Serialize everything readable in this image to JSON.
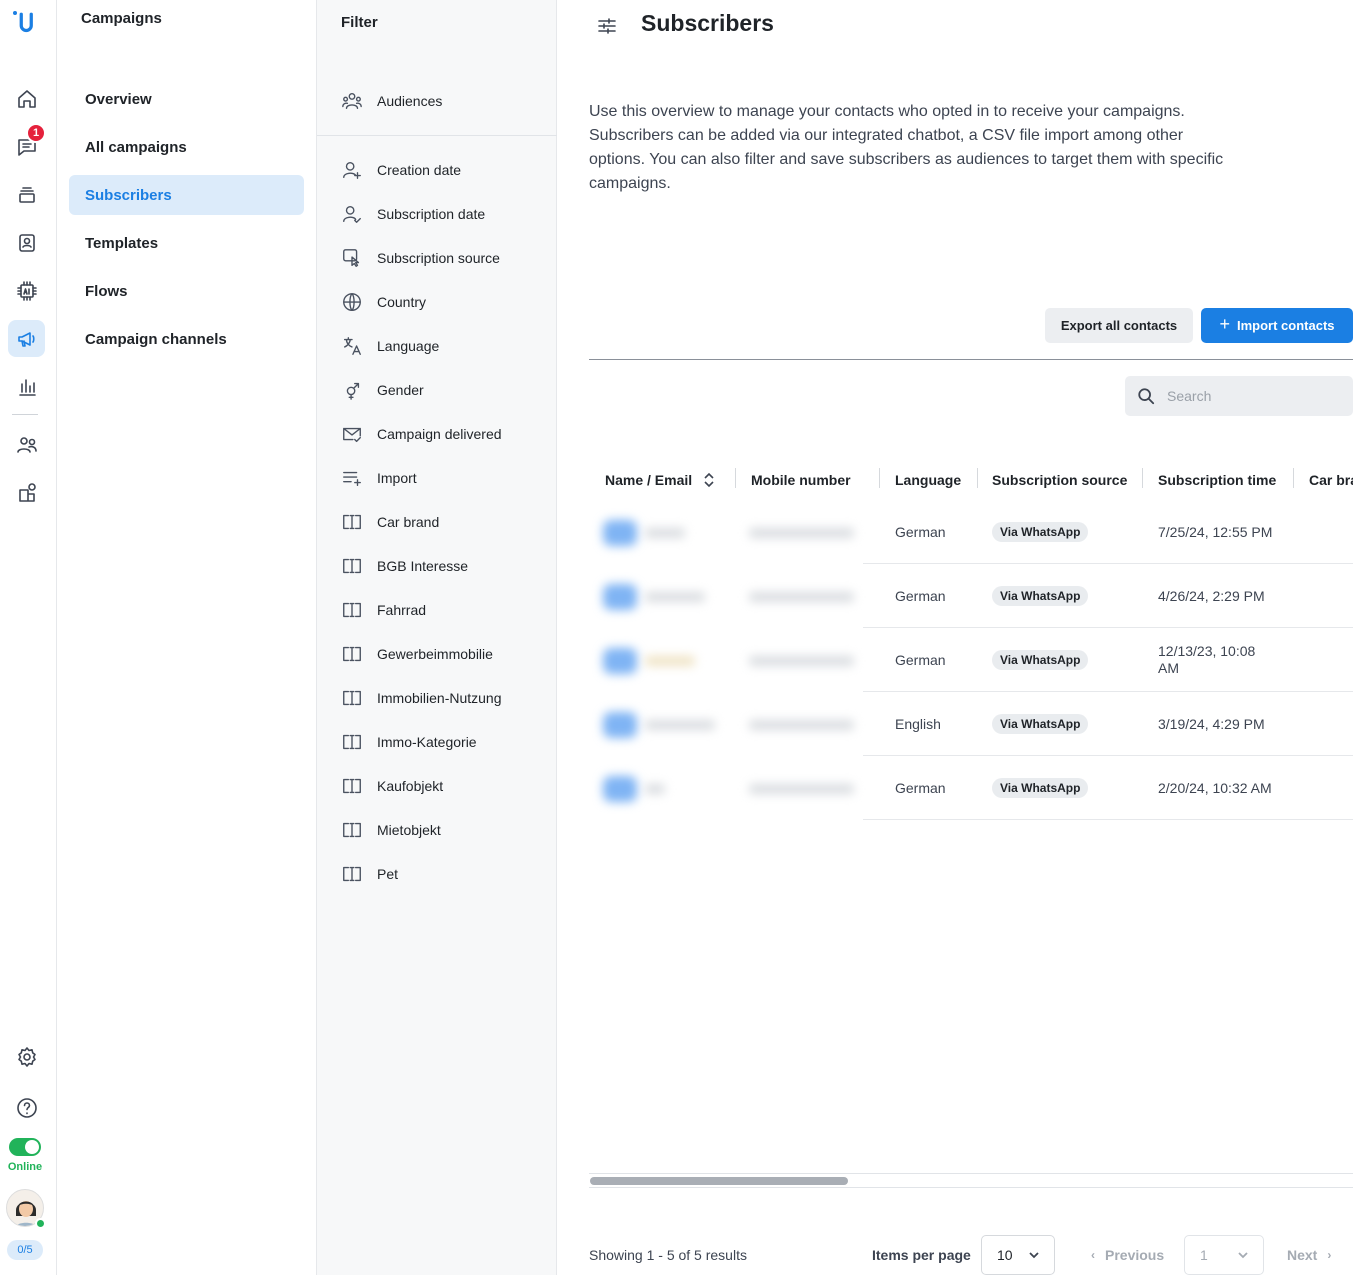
{
  "rail": {
    "notification_count": "1",
    "status": "Online",
    "agent_count": "0/5"
  },
  "nav": {
    "title": "Campaigns",
    "items": [
      "Overview",
      "All campaigns",
      "Subscribers",
      "Templates",
      "Flows",
      "Campaign channels"
    ]
  },
  "filter": {
    "title": "Filter",
    "audiences": "Audiences",
    "items": [
      "Creation date",
      "Subscription date",
      "Subscription source",
      "Country",
      "Language",
      "Gender",
      "Campaign delivered",
      "Import",
      "Car brand",
      "BGB Interesse",
      "Fahrrad",
      "Gewerbeimmobilie",
      "Immobilien-Nutzung",
      "Immo-Kategorie",
      "Kaufobjekt",
      "Mietobjekt",
      "Pet"
    ]
  },
  "main": {
    "title": "Subscribers",
    "description": "Use this overview to manage your contacts who opted in to receive your campaigns. Subscribers can be added via our integrated chatbot, a CSV file import among other options. You can also filter and save subscribers as audiences to target them with specific campaigns.",
    "export_label": "Export all contacts",
    "import_label": "Import contacts",
    "search_placeholder": "Search"
  },
  "table": {
    "headers": [
      "Name / Email",
      "Mobile number",
      "Language",
      "Subscription source",
      "Subscription time",
      "Car bra"
    ],
    "rows": [
      {
        "language": "German",
        "source": "Via WhatsApp",
        "time": "7/25/24, 12:55 PM"
      },
      {
        "language": "German",
        "source": "Via WhatsApp",
        "time": "4/26/24, 2:29 PM"
      },
      {
        "language": "German",
        "source": "Via WhatsApp",
        "time": "12/13/23, 10:08 AM"
      },
      {
        "language": "English",
        "source": "Via WhatsApp",
        "time": "3/19/24, 4:29 PM"
      },
      {
        "language": "German",
        "source": "Via WhatsApp",
        "time": "2/20/24, 10:32 AM"
      }
    ]
  },
  "footer": {
    "showing": "Showing 1 - 5 of 5 results",
    "items_per_page_label": "Items per page",
    "items_per_page": "10",
    "previous": "Previous",
    "page": "1",
    "next": "Next"
  },
  "colors": {
    "accent": "#1b7fe3",
    "active_bg": "#dcebfa",
    "online": "#21b35a",
    "badge": "#e5213c"
  }
}
